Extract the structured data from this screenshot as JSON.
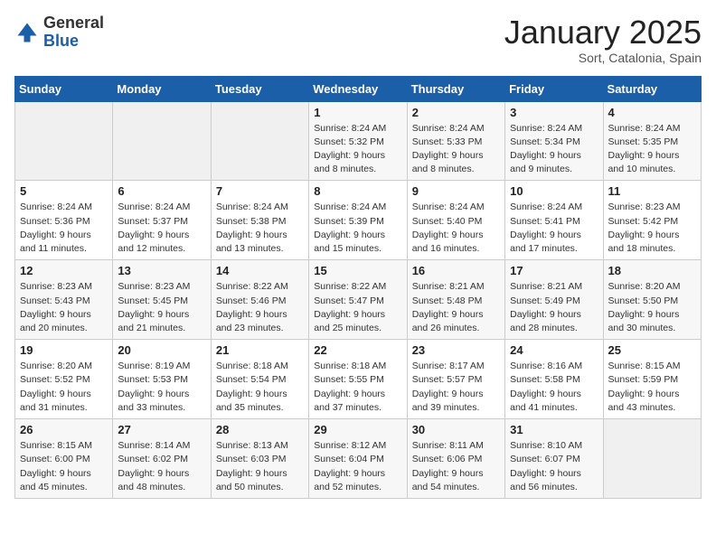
{
  "header": {
    "logo_general": "General",
    "logo_blue": "Blue",
    "month_title": "January 2025",
    "location": "Sort, Catalonia, Spain"
  },
  "weekdays": [
    "Sunday",
    "Monday",
    "Tuesday",
    "Wednesday",
    "Thursday",
    "Friday",
    "Saturday"
  ],
  "weeks": [
    [
      {
        "day": "",
        "sunrise": "",
        "sunset": "",
        "daylight": ""
      },
      {
        "day": "",
        "sunrise": "",
        "sunset": "",
        "daylight": ""
      },
      {
        "day": "",
        "sunrise": "",
        "sunset": "",
        "daylight": ""
      },
      {
        "day": "1",
        "sunrise": "Sunrise: 8:24 AM",
        "sunset": "Sunset: 5:32 PM",
        "daylight": "Daylight: 9 hours and 8 minutes."
      },
      {
        "day": "2",
        "sunrise": "Sunrise: 8:24 AM",
        "sunset": "Sunset: 5:33 PM",
        "daylight": "Daylight: 9 hours and 8 minutes."
      },
      {
        "day": "3",
        "sunrise": "Sunrise: 8:24 AM",
        "sunset": "Sunset: 5:34 PM",
        "daylight": "Daylight: 9 hours and 9 minutes."
      },
      {
        "day": "4",
        "sunrise": "Sunrise: 8:24 AM",
        "sunset": "Sunset: 5:35 PM",
        "daylight": "Daylight: 9 hours and 10 minutes."
      }
    ],
    [
      {
        "day": "5",
        "sunrise": "Sunrise: 8:24 AM",
        "sunset": "Sunset: 5:36 PM",
        "daylight": "Daylight: 9 hours and 11 minutes."
      },
      {
        "day": "6",
        "sunrise": "Sunrise: 8:24 AM",
        "sunset": "Sunset: 5:37 PM",
        "daylight": "Daylight: 9 hours and 12 minutes."
      },
      {
        "day": "7",
        "sunrise": "Sunrise: 8:24 AM",
        "sunset": "Sunset: 5:38 PM",
        "daylight": "Daylight: 9 hours and 13 minutes."
      },
      {
        "day": "8",
        "sunrise": "Sunrise: 8:24 AM",
        "sunset": "Sunset: 5:39 PM",
        "daylight": "Daylight: 9 hours and 15 minutes."
      },
      {
        "day": "9",
        "sunrise": "Sunrise: 8:24 AM",
        "sunset": "Sunset: 5:40 PM",
        "daylight": "Daylight: 9 hours and 16 minutes."
      },
      {
        "day": "10",
        "sunrise": "Sunrise: 8:24 AM",
        "sunset": "Sunset: 5:41 PM",
        "daylight": "Daylight: 9 hours and 17 minutes."
      },
      {
        "day": "11",
        "sunrise": "Sunrise: 8:23 AM",
        "sunset": "Sunset: 5:42 PM",
        "daylight": "Daylight: 9 hours and 18 minutes."
      }
    ],
    [
      {
        "day": "12",
        "sunrise": "Sunrise: 8:23 AM",
        "sunset": "Sunset: 5:43 PM",
        "daylight": "Daylight: 9 hours and 20 minutes."
      },
      {
        "day": "13",
        "sunrise": "Sunrise: 8:23 AM",
        "sunset": "Sunset: 5:45 PM",
        "daylight": "Daylight: 9 hours and 21 minutes."
      },
      {
        "day": "14",
        "sunrise": "Sunrise: 8:22 AM",
        "sunset": "Sunset: 5:46 PM",
        "daylight": "Daylight: 9 hours and 23 minutes."
      },
      {
        "day": "15",
        "sunrise": "Sunrise: 8:22 AM",
        "sunset": "Sunset: 5:47 PM",
        "daylight": "Daylight: 9 hours and 25 minutes."
      },
      {
        "day": "16",
        "sunrise": "Sunrise: 8:21 AM",
        "sunset": "Sunset: 5:48 PM",
        "daylight": "Daylight: 9 hours and 26 minutes."
      },
      {
        "day": "17",
        "sunrise": "Sunrise: 8:21 AM",
        "sunset": "Sunset: 5:49 PM",
        "daylight": "Daylight: 9 hours and 28 minutes."
      },
      {
        "day": "18",
        "sunrise": "Sunrise: 8:20 AM",
        "sunset": "Sunset: 5:50 PM",
        "daylight": "Daylight: 9 hours and 30 minutes."
      }
    ],
    [
      {
        "day": "19",
        "sunrise": "Sunrise: 8:20 AM",
        "sunset": "Sunset: 5:52 PM",
        "daylight": "Daylight: 9 hours and 31 minutes."
      },
      {
        "day": "20",
        "sunrise": "Sunrise: 8:19 AM",
        "sunset": "Sunset: 5:53 PM",
        "daylight": "Daylight: 9 hours and 33 minutes."
      },
      {
        "day": "21",
        "sunrise": "Sunrise: 8:18 AM",
        "sunset": "Sunset: 5:54 PM",
        "daylight": "Daylight: 9 hours and 35 minutes."
      },
      {
        "day": "22",
        "sunrise": "Sunrise: 8:18 AM",
        "sunset": "Sunset: 5:55 PM",
        "daylight": "Daylight: 9 hours and 37 minutes."
      },
      {
        "day": "23",
        "sunrise": "Sunrise: 8:17 AM",
        "sunset": "Sunset: 5:57 PM",
        "daylight": "Daylight: 9 hours and 39 minutes."
      },
      {
        "day": "24",
        "sunrise": "Sunrise: 8:16 AM",
        "sunset": "Sunset: 5:58 PM",
        "daylight": "Daylight: 9 hours and 41 minutes."
      },
      {
        "day": "25",
        "sunrise": "Sunrise: 8:15 AM",
        "sunset": "Sunset: 5:59 PM",
        "daylight": "Daylight: 9 hours and 43 minutes."
      }
    ],
    [
      {
        "day": "26",
        "sunrise": "Sunrise: 8:15 AM",
        "sunset": "Sunset: 6:00 PM",
        "daylight": "Daylight: 9 hours and 45 minutes."
      },
      {
        "day": "27",
        "sunrise": "Sunrise: 8:14 AM",
        "sunset": "Sunset: 6:02 PM",
        "daylight": "Daylight: 9 hours and 48 minutes."
      },
      {
        "day": "28",
        "sunrise": "Sunrise: 8:13 AM",
        "sunset": "Sunset: 6:03 PM",
        "daylight": "Daylight: 9 hours and 50 minutes."
      },
      {
        "day": "29",
        "sunrise": "Sunrise: 8:12 AM",
        "sunset": "Sunset: 6:04 PM",
        "daylight": "Daylight: 9 hours and 52 minutes."
      },
      {
        "day": "30",
        "sunrise": "Sunrise: 8:11 AM",
        "sunset": "Sunset: 6:06 PM",
        "daylight": "Daylight: 9 hours and 54 minutes."
      },
      {
        "day": "31",
        "sunrise": "Sunrise: 8:10 AM",
        "sunset": "Sunset: 6:07 PM",
        "daylight": "Daylight: 9 hours and 56 minutes."
      },
      {
        "day": "",
        "sunrise": "",
        "sunset": "",
        "daylight": ""
      }
    ]
  ]
}
